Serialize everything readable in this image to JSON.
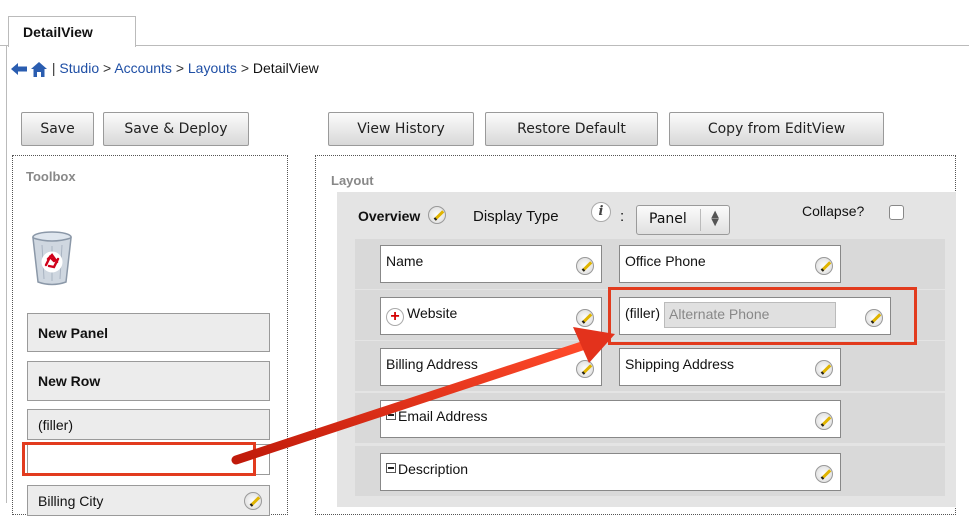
{
  "tab": {
    "label": "DetailView"
  },
  "breadcrumb": {
    "separator": "|",
    "studio": "Studio",
    "accounts": "Accounts",
    "layouts": "Layouts",
    "current": "DetailView",
    "gt": ">"
  },
  "toolbar": {
    "save": "Save",
    "save_deploy": "Save & Deploy",
    "view_history": "View History",
    "restore_default": "Restore Default",
    "copy_from_editview": "Copy from EditView"
  },
  "toolbox": {
    "title": "Toolbox",
    "new_panel": "New Panel",
    "new_row": "New Row",
    "filler": "(filler)",
    "billing_city": "Billing City"
  },
  "layout": {
    "title": "Layout",
    "panel_name": "Overview",
    "display_type_label": "Display Type",
    "info_symbol": "i",
    "colon": ":",
    "display_type_value": "Panel",
    "collapse_label": "Collapse?",
    "rows": [
      {
        "left": "Name",
        "right": "Office Phone"
      },
      {
        "left": "Website",
        "right_filler": "(filler)",
        "right_ghost": "Alternate Phone"
      },
      {
        "left": "Billing Address",
        "right": "Shipping Address"
      },
      {
        "full": "Email Address"
      },
      {
        "full": "Description"
      }
    ]
  },
  "colors": {
    "highlight": "#e23b1e",
    "link": "#1f4fa5",
    "panel_bg": "#e4e4e4"
  }
}
